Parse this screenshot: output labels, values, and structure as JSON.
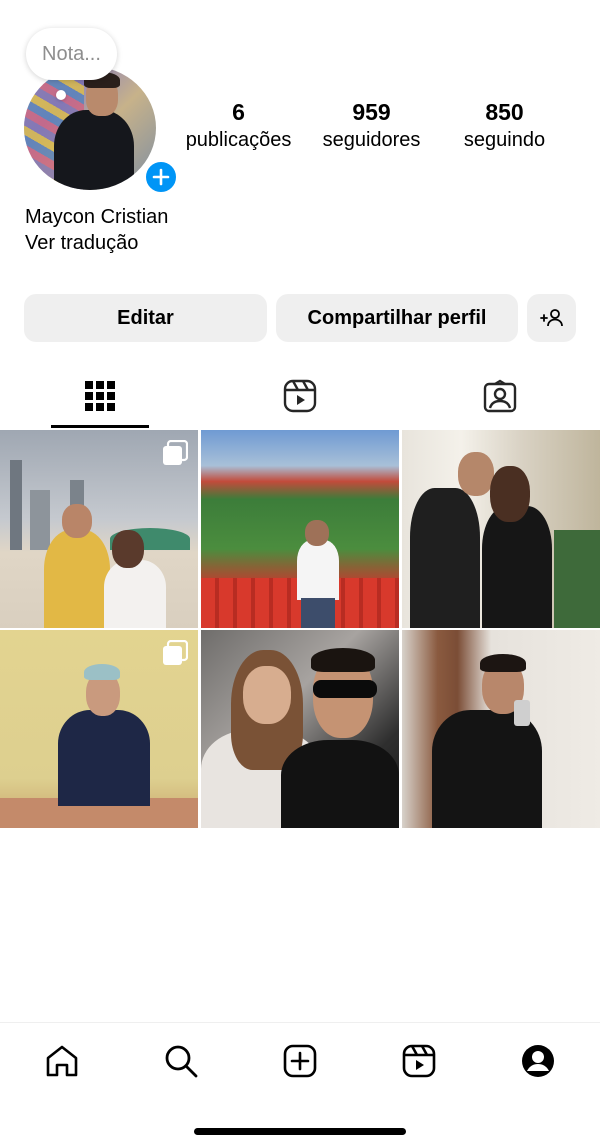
{
  "profile": {
    "note_placeholder": "Nota...",
    "name": "Maycon Cristian",
    "translate_link": "Ver tradução",
    "stats": [
      {
        "value": "6",
        "label": "publicações"
      },
      {
        "value": "959",
        "label": "seguidores"
      },
      {
        "value": "850",
        "label": "seguindo"
      }
    ]
  },
  "actions": {
    "edit_label": "Editar",
    "share_label": "Compartilhar perfil"
  },
  "tabs": [
    {
      "icon": "grid-icon",
      "active": true
    },
    {
      "icon": "reels-icon",
      "active": false
    },
    {
      "icon": "tagged-icon",
      "active": false
    }
  ],
  "posts": [
    {
      "scene": "beach selfie couple",
      "multi": true
    },
    {
      "scene": "stadium seats",
      "multi": false
    },
    {
      "scene": "couple with curtains",
      "multi": false
    },
    {
      "scene": "woman at table",
      "multi": true
    },
    {
      "scene": "couple car selfie",
      "multi": false
    },
    {
      "scene": "mirror selfie",
      "multi": false
    }
  ],
  "bottom_nav": [
    {
      "icon": "home-icon"
    },
    {
      "icon": "search-icon"
    },
    {
      "icon": "create-icon"
    },
    {
      "icon": "reels-icon"
    },
    {
      "icon": "profile-icon"
    }
  ],
  "colors": {
    "accent": "#0095f6",
    "button_bg": "#efefef",
    "text": "#000000",
    "muted": "#8e8e8e"
  }
}
